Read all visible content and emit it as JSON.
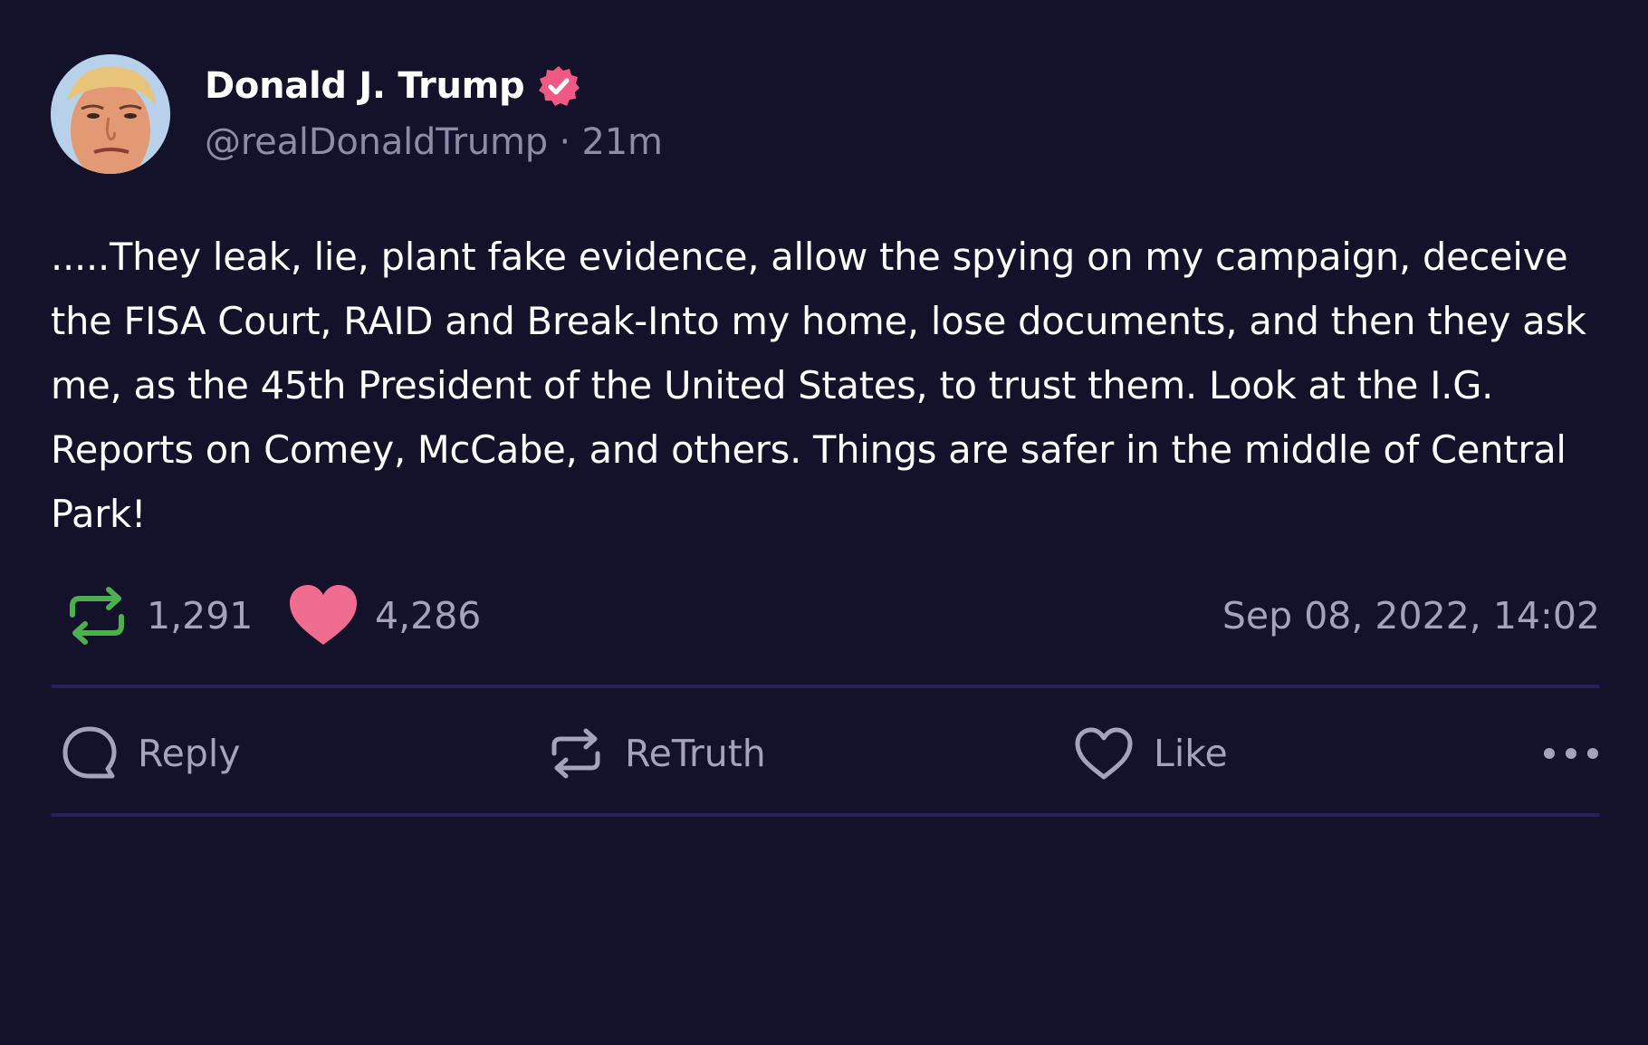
{
  "post": {
    "author": {
      "name": "Donald J. Trump",
      "handle": "@realDonaldTrump",
      "separator": "·",
      "age": "21m",
      "verified_color": "#ef5a84"
    },
    "text": ".....They leak, lie, plant fake evidence, allow the spying on my campaign, deceive the FISA Court, RAID and Break-Into my home, lose documents, and then they ask me, as the 45th President of the United States, to trust them. Look at the I.G. Reports on Comey, McCabe, and others. Things are safer in the middle of Central Park!",
    "stats": {
      "retruths": "1,291",
      "likes": "4,286",
      "timestamp": "Sep 08, 2022, 14:02"
    },
    "actions": {
      "reply_label": "Reply",
      "retruth_label": "ReTruth",
      "like_label": "Like"
    },
    "icons": {
      "stat_retruth": "retruth-icon",
      "stat_like": "heart-filled-icon",
      "reply": "comment-bubble-icon",
      "retruth": "retruth-icon",
      "like": "heart-outline-icon",
      "more": "more-horizontal-icon"
    },
    "colors": {
      "background": "#14112b",
      "retruth_green": "#4caf50",
      "like_pink": "#ef6b8f",
      "muted_text": "#a6a2bd",
      "divider": "#25215a"
    }
  }
}
